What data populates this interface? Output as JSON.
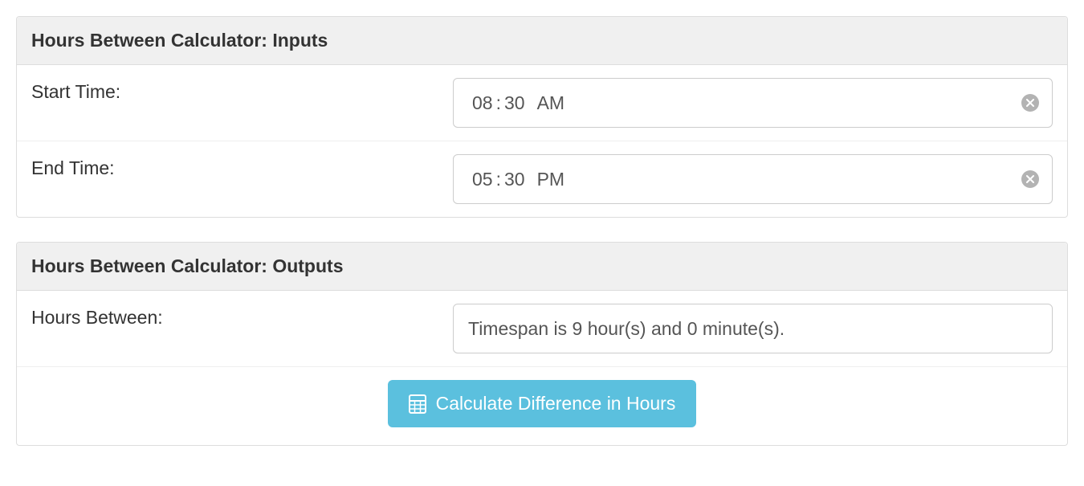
{
  "inputs": {
    "heading": "Hours Between Calculator: Inputs",
    "start": {
      "label": "Start Time:",
      "hour": "08",
      "minute": "30",
      "ampm": "AM"
    },
    "end": {
      "label": "End Time:",
      "hour": "05",
      "minute": "30",
      "ampm": "PM"
    }
  },
  "outputs": {
    "heading": "Hours Between Calculator: Outputs",
    "hours_between_label": "Hours Between:",
    "result": "Timespan is 9 hour(s) and 0 minute(s).",
    "button_label": "Calculate Difference in Hours"
  }
}
